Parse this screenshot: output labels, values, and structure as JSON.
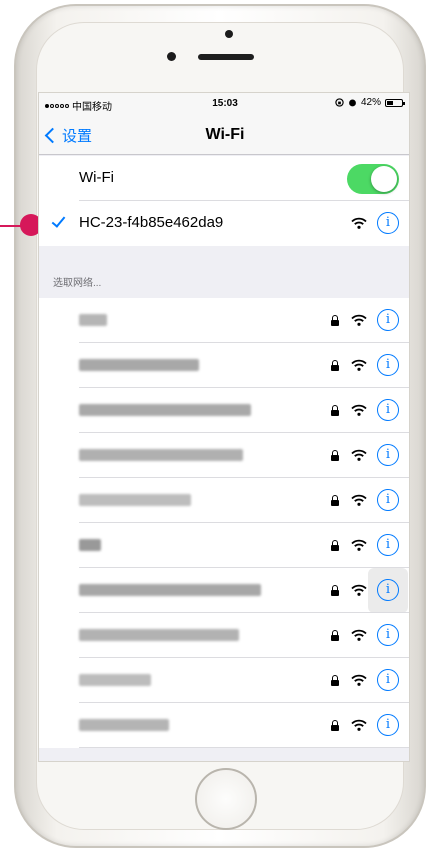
{
  "status_bar": {
    "carrier": "中国移动",
    "time": "15:03",
    "battery": "42%",
    "battery_level": 0.42
  },
  "nav": {
    "back_label": "设置",
    "title": "Wi-Fi"
  },
  "wifi_toggle": {
    "label": "Wi-Fi",
    "on": true
  },
  "connected_network": {
    "name": "HC-23-f4b85e462da9"
  },
  "section": {
    "header": "选取网络..."
  },
  "networks": [
    {
      "name": "",
      "locked": true
    },
    {
      "name": "",
      "locked": true
    },
    {
      "name": "",
      "locked": true
    },
    {
      "name": "",
      "locked": true
    },
    {
      "name": "",
      "locked": true
    },
    {
      "name": "",
      "locked": true
    },
    {
      "name": "",
      "locked": true
    },
    {
      "name": "",
      "locked": true
    },
    {
      "name": "",
      "locked": true
    },
    {
      "name": "",
      "locked": true
    }
  ],
  "colors": {
    "accent": "#007aff",
    "toggle_on": "#4cd964",
    "pointer": "#d6185a"
  }
}
